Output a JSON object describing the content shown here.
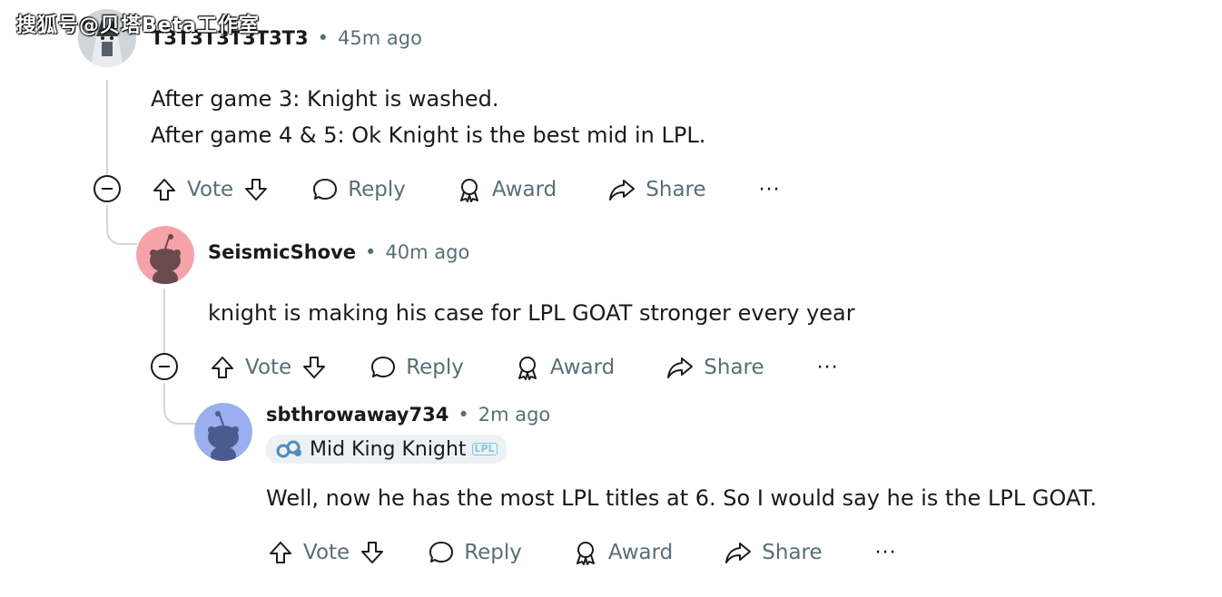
{
  "watermark": "搜狐号@贝塔Beta工作室",
  "actions": {
    "vote": "Vote",
    "reply": "Reply",
    "award": "Award",
    "share": "Share",
    "more": "···"
  },
  "comments": [
    {
      "username": "T3T3T3T3T3T3",
      "time": "45m ago",
      "lines": [
        "After game 3: Knight is washed.",
        "After game 4 & 5: Ok Knight is the best mid in LPL."
      ]
    },
    {
      "username": "SeismicShove",
      "time": "40m ago",
      "lines": [
        "knight is making his case for LPL GOAT stronger every year"
      ],
      "avatar_color": "#f5a3a8"
    },
    {
      "username": "sbthrowaway734",
      "time": "2m ago",
      "flair": "Mid King Knight",
      "flair_badge": "LPL",
      "lines": [
        "Well, now he has the most LPL titles at 6. So I would say he is the LPL GOAT."
      ],
      "avatar_color": "#9aaef0"
    }
  ],
  "separator": "•"
}
